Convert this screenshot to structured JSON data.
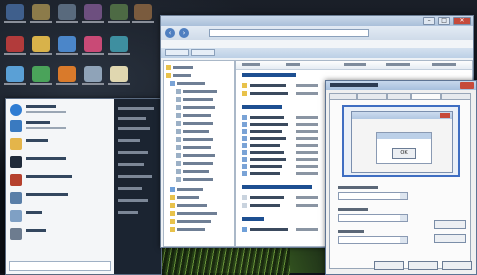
{
  "explorer": {
    "title": "",
    "address": "",
    "menu": [
      "",
      "",
      "",
      "",
      ""
    ],
    "window_buttons": {
      "minimize": "–",
      "maximize": "□",
      "close": "✕"
    },
    "nav": {
      "back": "‹",
      "forward": "›"
    }
  },
  "preview": {
    "ok_label": "OK"
  },
  "colors": {
    "selection": "#3f6ec2",
    "close": "#c64a3b"
  }
}
